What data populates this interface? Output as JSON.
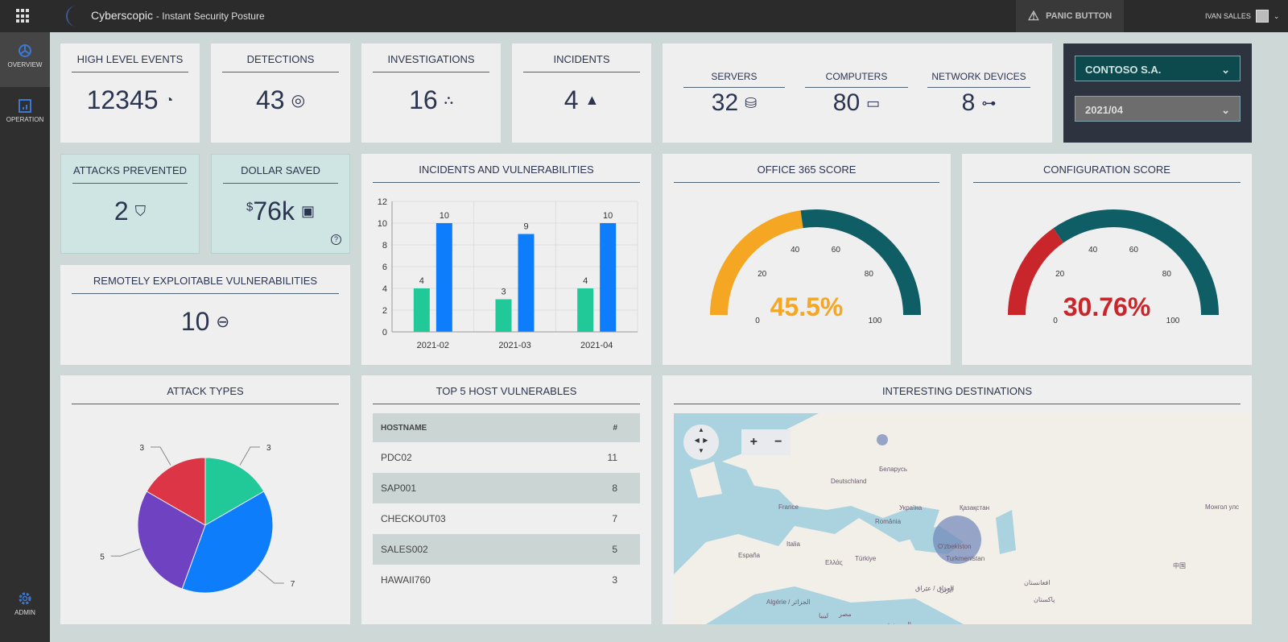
{
  "header": {
    "app_name": "Cyberscopic",
    "subtitle": "- Instant Security Posture",
    "panic_label": "PANIC BUTTON",
    "user": "IVAN SALLES"
  },
  "sidebar": {
    "items": [
      {
        "label": "OVERVIEW",
        "icon": "pie-chart-icon"
      },
      {
        "label": "OPERATION",
        "icon": "clipboard-chart-icon"
      },
      {
        "label": "ADMIN",
        "icon": "gear-icon"
      }
    ]
  },
  "kpis": [
    {
      "label": "HIGH LEVEL EVENTS",
      "value": "12345",
      "icon": "speedometer-icon"
    },
    {
      "label": "DETECTIONS",
      "value": "43",
      "icon": "target-icon"
    },
    {
      "label": "INVESTIGATIONS",
      "value": "16",
      "icon": "binoculars-icon"
    },
    {
      "label": "INCIDENTS",
      "value": "4",
      "icon": "traffic-cone-icon"
    }
  ],
  "assets": [
    {
      "label": "SERVERS",
      "value": "32",
      "icon": "database-icon"
    },
    {
      "label": "COMPUTERS",
      "value": "80",
      "icon": "laptop-icon"
    },
    {
      "label": "NETWORK DEVICES",
      "value": "8",
      "icon": "network-icon"
    }
  ],
  "filters": {
    "company": "CONTOSO S.A.",
    "period": "2021/04"
  },
  "attacks_prevented": {
    "label": "ATTACKS PREVENTED",
    "value": "2"
  },
  "dollar_saved": {
    "label": "DOLLAR SAVED",
    "currency": "$",
    "value": "76k"
  },
  "remote_vulns": {
    "label": "REMOTELY EXPLOITABLE VULNERABILITIES",
    "value": "10"
  },
  "colors": {
    "green": "#20c997",
    "blue": "#0d7dfc",
    "orange": "#f5a623",
    "teal": "#0f5e66",
    "red": "#c9262c",
    "purple": "#6f42c1",
    "pie_red": "#dc3545"
  },
  "chart_data": [
    {
      "type": "bar",
      "title": "INCIDENTS AND VULNERABILITIES",
      "categories": [
        "2021-02",
        "2021-03",
        "2021-04"
      ],
      "series": [
        {
          "values": [
            4,
            3,
            4
          ],
          "color": "#20c997"
        },
        {
          "values": [
            10,
            9,
            10
          ],
          "color": "#0d7dfc"
        }
      ],
      "ylim": [
        0,
        12
      ],
      "yticks": [
        0,
        2,
        4,
        6,
        8,
        10,
        12
      ],
      "grid": true
    },
    {
      "type": "gauge",
      "title": "OFFICE 365 SCORE",
      "value": 45.5,
      "display": "45.5%",
      "range": [
        0,
        100
      ],
      "ticks": [
        0,
        20,
        40,
        60,
        80,
        100
      ],
      "color": "#f5a623"
    },
    {
      "type": "gauge",
      "title": "CONFIGURATION SCORE",
      "value": 30.76,
      "display": "30.76%",
      "range": [
        0,
        100
      ],
      "ticks": [
        0,
        20,
        40,
        60,
        80,
        100
      ],
      "color": "#c9262c"
    },
    {
      "type": "pie",
      "title": "ATTACK TYPES",
      "values": [
        3,
        7,
        5,
        3
      ],
      "colors": [
        "#20c997",
        "#0d7dfc",
        "#6f42c1",
        "#dc3545"
      ]
    }
  ],
  "top_hosts": {
    "title": "TOP 5 HOST VULNERABLES",
    "columns": [
      "HOSTNAME",
      "#"
    ],
    "rows": [
      [
        "PDC02",
        "11"
      ],
      [
        "SAP001",
        "8"
      ],
      [
        "CHECKOUT03",
        "7"
      ],
      [
        "SALES002",
        "5"
      ],
      [
        "HAWAII760",
        "3"
      ]
    ]
  },
  "map": {
    "title": "INTERESTING DESTINATIONS",
    "labels": [
      "Беларусь",
      "Deutschland",
      "France",
      "Україна",
      "România",
      "Қазақстан",
      "Монгол улс",
      "Italia",
      "España",
      "Ελλάς",
      "Türkiye",
      "O'zbekiston",
      "Turkmenistan",
      "中国",
      "العراق / عێراق",
      "ایران",
      "افغانستان",
      "پاکستان",
      "Algérie / الجزائر",
      "ليبيا",
      "مصر",
      "السعودية"
    ],
    "zoom_in": "+",
    "zoom_out": "−"
  }
}
